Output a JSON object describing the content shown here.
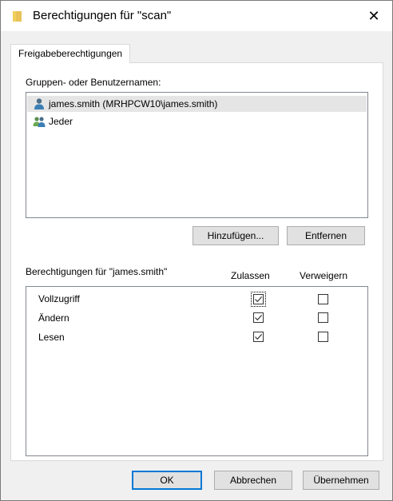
{
  "window": {
    "title": "Berechtigungen für \"scan\"",
    "close_glyph": "✕"
  },
  "tabs": [
    {
      "label": "Freigabeberechtigungen",
      "active": true
    }
  ],
  "groups": {
    "label": "Gruppen- oder Benutzernamen:",
    "items": [
      {
        "label": "james.smith (MRHPCW10\\james.smith)",
        "icon": "user-icon",
        "selected": true
      },
      {
        "label": "Jeder",
        "icon": "group-icon",
        "selected": false
      }
    ],
    "add_button": "Hinzufügen...",
    "remove_button": "Entfernen"
  },
  "permissions": {
    "label": "Berechtigungen für \"james.smith\"",
    "col_allow": "Zulassen",
    "col_deny": "Verweigern",
    "rows": [
      {
        "name": "Vollzugriff",
        "allow": true,
        "deny": false
      },
      {
        "name": "Ändern",
        "allow": true,
        "deny": false
      },
      {
        "name": "Lesen",
        "allow": true,
        "deny": false
      }
    ]
  },
  "footer": {
    "ok": "OK",
    "cancel": "Abbrechen",
    "apply": "Übernehmen"
  },
  "colors": {
    "accent": "#0078d7",
    "selection": "#e5e5e5",
    "dialog_bg": "#f0f0f0"
  }
}
